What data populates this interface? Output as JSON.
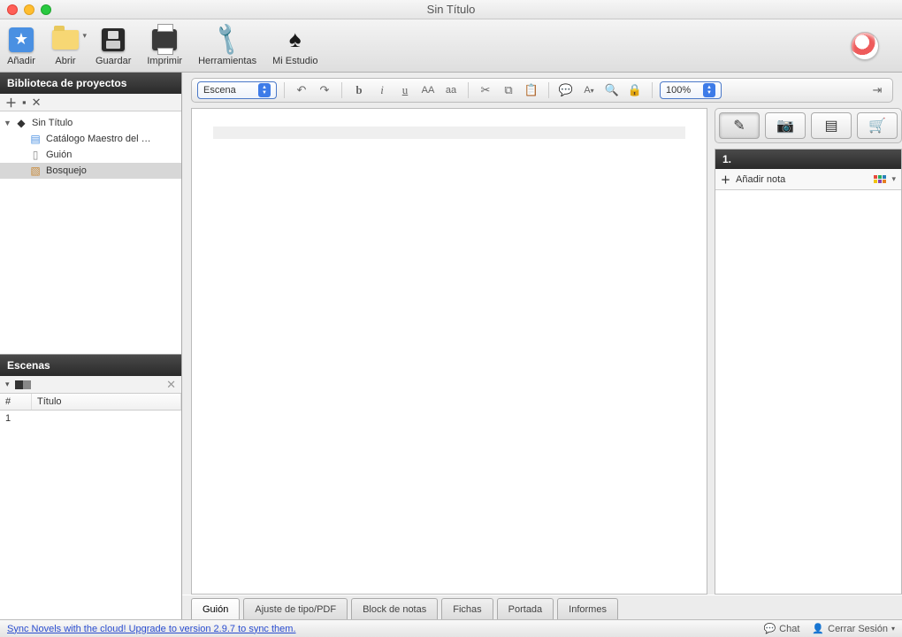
{
  "window": {
    "title": "Sin Título"
  },
  "toolbar": {
    "add": "Añadir",
    "open": "Abrir",
    "save": "Guardar",
    "print": "Imprimir",
    "tools": "Herramientas",
    "studio": "Mi Estudio"
  },
  "sidebar": {
    "library_title": "Biblioteca de proyectos",
    "tree": {
      "root": "Sin Título",
      "items": [
        "Catálogo Maestro del …",
        "Guión",
        "Bosquejo"
      ]
    },
    "scenes_title": "Escenas",
    "scenes_cols": {
      "num": "#",
      "title": "Título"
    },
    "scenes_rows": [
      {
        "num": "1",
        "title": ""
      }
    ]
  },
  "editor": {
    "element_type": "Escena",
    "zoom": "100%"
  },
  "right": {
    "section_number": "1.",
    "add_note": "Añadir nota"
  },
  "bottom_tabs": {
    "script": "Guión",
    "typeset": "Ajuste de tipo/PDF",
    "notepad": "Block de notas",
    "cards": "Fichas",
    "cover": "Portada",
    "reports": "Informes"
  },
  "status": {
    "sync_msg": "Sync Novels with the cloud! Upgrade to version 2.9.7 to sync them.",
    "chat": "Chat",
    "logout": "Cerrar Sesión"
  }
}
